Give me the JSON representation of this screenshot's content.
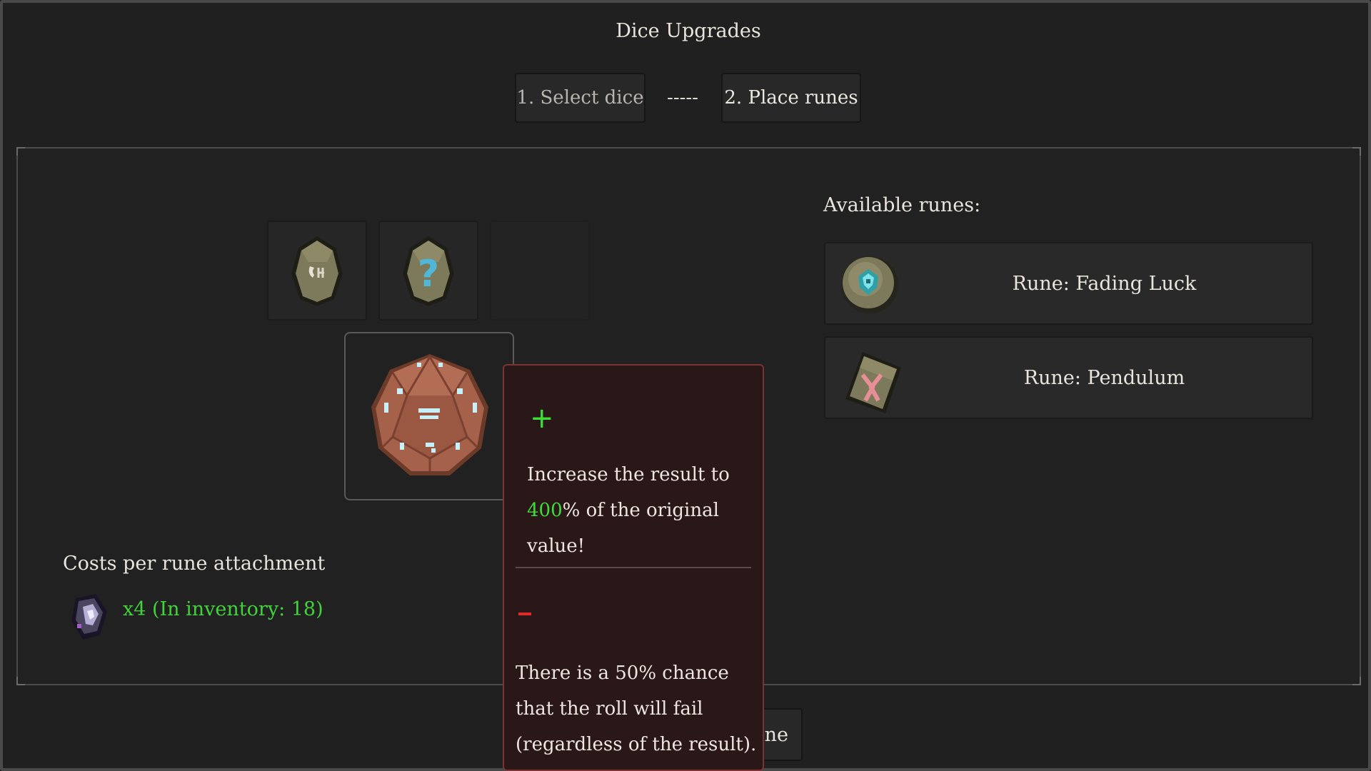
{
  "title": "Dice Upgrades",
  "steps": {
    "step1": "1. Select dice",
    "separator": "-----",
    "step2": "2. Place runes"
  },
  "rune_slots": [
    {
      "icon": "runestone-symbol-icon",
      "filled": true
    },
    {
      "icon": "runestone-question-icon",
      "filled": true
    },
    {
      "icon": "",
      "filled": false
    }
  ],
  "selected_die": {
    "icon": "d20-die-icon"
  },
  "available_runes": {
    "label": "Available runes:",
    "items": [
      {
        "name": "Rune: Fading Luck",
        "icon": "fading-luck-rune-icon"
      },
      {
        "name": "Rune: Pendulum",
        "icon": "pendulum-rune-icon"
      }
    ]
  },
  "cost": {
    "title": "Costs per rune attachment",
    "text": "x4 (In inventory: 18)",
    "icon": "crystal-shard-icon",
    "color": "#41d33a"
  },
  "bottom_button": {
    "visible_label": "une"
  },
  "tooltip": {
    "plus_symbol": "+",
    "positive_pre": "Increase the result to ",
    "positive_value": "400",
    "positive_post": "% of the original value!",
    "negative_text": "There is a 50% chance that the roll will fail (regardless of the result).",
    "positive_color": "#3dde38",
    "negative_color": "#e02a2a"
  }
}
